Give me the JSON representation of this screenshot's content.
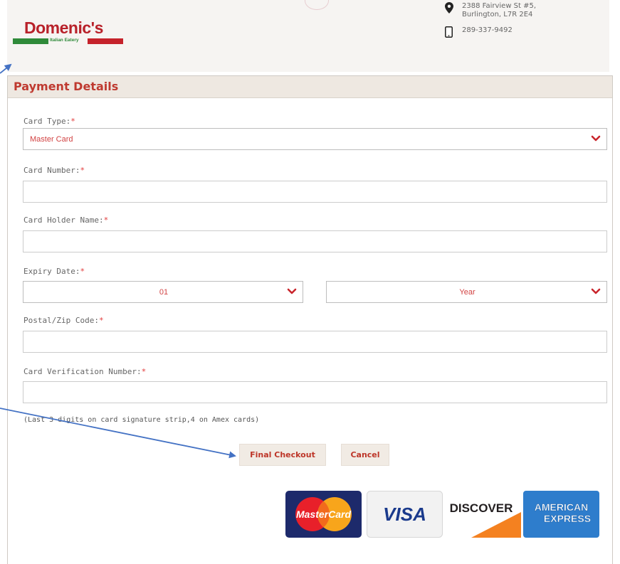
{
  "header": {
    "logo": {
      "name": "Domenic's",
      "tagline": "Italian Eatery"
    },
    "address_line1": "2388 Fairview St #5,",
    "address_line2": "Burlington, L7R 2E4",
    "phone": "289-337-9492"
  },
  "panel": {
    "title": "Payment Details"
  },
  "form": {
    "required_marker": "*",
    "card_type_label": "Card Type:",
    "card_type_value": "Master Card",
    "card_number_label": "Card Number:",
    "card_holder_label": "Card Holder Name:",
    "expiry_label": "Expiry Date:",
    "expiry_month_value": "01",
    "expiry_year_value": "Year",
    "postal_label": "Postal/Zip Code:",
    "cvn_label": "Card Verification Number:",
    "cvn_hint": "(Last 3 digits on card signature strip,4 on Amex cards)"
  },
  "buttons": {
    "checkout": "Final Checkout",
    "cancel": "Cancel"
  },
  "accepted_cards": [
    {
      "name": "MasterCard",
      "icon": "mastercard-logo"
    },
    {
      "name": "VISA",
      "icon": "visa-logo"
    },
    {
      "name": "DISCOVER",
      "icon": "discover-logo"
    },
    {
      "name": "AMERICAN EXPRESS",
      "icon": "amex-logo",
      "line1": "AMERICAN",
      "line2": "EXPRESS"
    }
  ],
  "colors": {
    "accent_red": "#bf3a30",
    "header_bg": "#eee8e1",
    "required": "#e23b3b",
    "annotation_arrow": "#4472c4"
  }
}
